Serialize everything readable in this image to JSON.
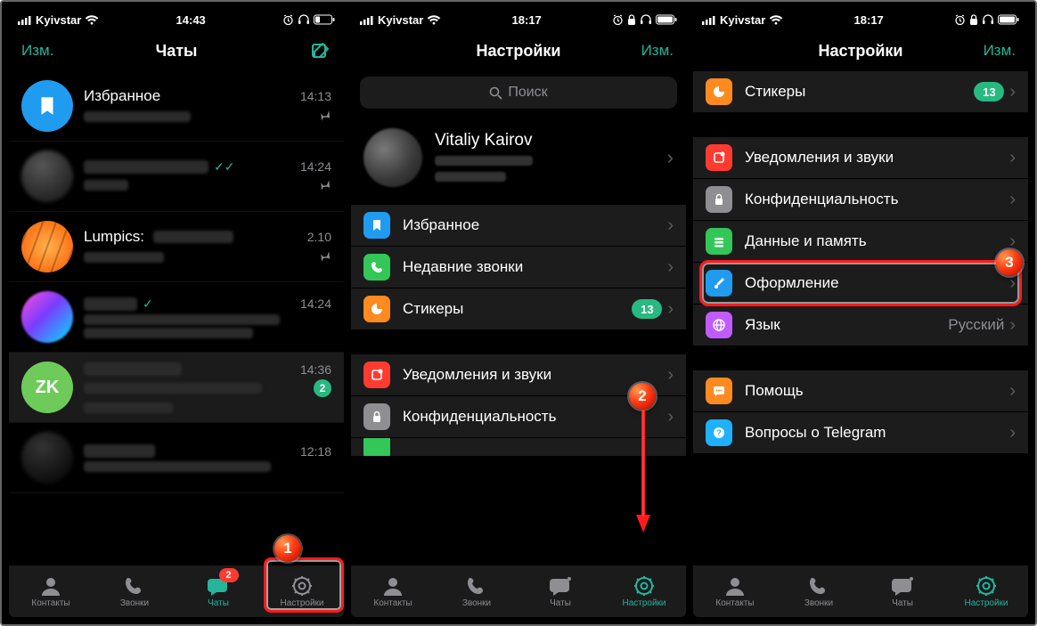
{
  "statusbar": {
    "carrier": "Kyivstar"
  },
  "times": {
    "s1": "14:43",
    "s2": "18:17",
    "s3": "18:17"
  },
  "header": {
    "edit": "Изм.",
    "chats_title": "Чаты",
    "settings_title": "Настройки"
  },
  "search": {
    "placeholder": "Поиск"
  },
  "profile": {
    "name": "Vitaliy Kairov"
  },
  "chats": [
    {
      "name": "Избранное",
      "time": "14:13",
      "pinned": true,
      "ticks": false,
      "avatar": "bookmark"
    },
    {
      "name": "blur",
      "time": "14:24",
      "pinned": true,
      "ticks": true,
      "avatar": "grad1"
    },
    {
      "name": "Lumpics:",
      "time": "2.10",
      "pinned": true,
      "ticks": false,
      "avatar": "orange"
    },
    {
      "name": "blur",
      "time": "14:24",
      "pinned": false,
      "ticks": true,
      "avatar": "palm"
    },
    {
      "name": "ZK",
      "time": "14:36",
      "pinned": false,
      "ticks": false,
      "avatar": "zk",
      "unread": "2",
      "sel": true
    },
    {
      "name": "blur",
      "time": "12:18",
      "pinned": false,
      "ticks": false,
      "avatar": "grad2"
    }
  ],
  "settings": {
    "group1": [
      {
        "icon": "bookmark",
        "bg": "#1f9cf0",
        "label": "Избранное"
      },
      {
        "icon": "phone",
        "bg": "#33c758",
        "label": "Недавние звонки"
      },
      {
        "icon": "sticker",
        "bg": "#ff8a1f",
        "label": "Стикеры",
        "badge": "13"
      }
    ],
    "group2": [
      {
        "icon": "bell",
        "bg": "#ff3b30",
        "label": "Уведомления и звуки"
      },
      {
        "icon": "lock",
        "bg": "#8e8e93",
        "label": "Конфиденциальность"
      },
      {
        "icon": "data",
        "bg": "#33c758",
        "label": "Данные и память"
      },
      {
        "icon": "brush",
        "bg": "#1f9cf0",
        "label": "Оформление"
      },
      {
        "icon": "globe",
        "bg": "#c05cff",
        "label": "Язык",
        "value": "Русский"
      }
    ],
    "group3": [
      {
        "icon": "help",
        "bg": "#ff8a1f",
        "label": "Помощь"
      },
      {
        "icon": "faq",
        "bg": "#1fb0ff",
        "label": "Вопросы о Telegram"
      }
    ]
  },
  "tabs": {
    "contacts": "Контакты",
    "calls": "Звонки",
    "chats": "Чаты",
    "settings": "Настройки",
    "chats_badge": "2"
  },
  "annotations": {
    "n1": "1",
    "n2": "2",
    "n3": "3"
  }
}
